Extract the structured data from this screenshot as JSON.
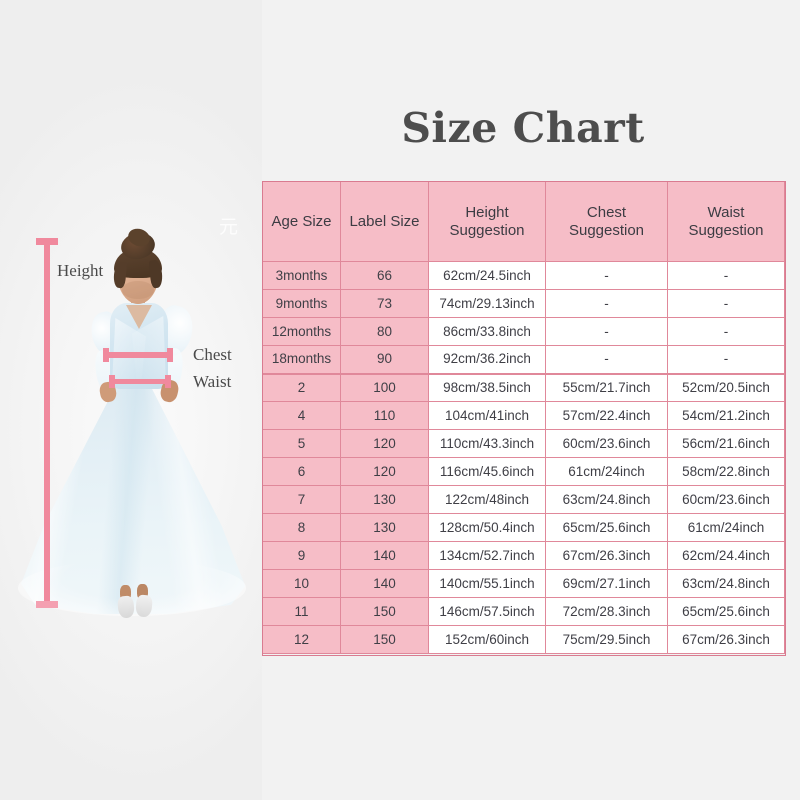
{
  "title": "Size Chart",
  "watermark": "元",
  "photo": {
    "alt_name": "girl-in-light-blue-tulle-dress",
    "annotations": [
      {
        "id": "height",
        "label": "Height"
      },
      {
        "id": "chest",
        "label": "Chest"
      },
      {
        "id": "waist",
        "label": "Waist"
      }
    ]
  },
  "colors": {
    "page_background": "#f2f2f2",
    "header_fill": "#f6bdc7",
    "cell_pink_fill": "#f6bdc7",
    "cell_white_fill": "#ffffff",
    "table_border": "#e0889a",
    "caliper_pink": "#f0899d",
    "title_text": "#4d4d4d",
    "body_text": "#3f3f46",
    "dress_blue": "#d3e6f1"
  },
  "chart_data": {
    "type": "table",
    "title": "Size Chart",
    "columns": [
      {
        "key": "age",
        "label": "Age Size",
        "lines": [
          "Age Size"
        ]
      },
      {
        "key": "label",
        "label": "Label Size",
        "lines": [
          "Label Size"
        ]
      },
      {
        "key": "height",
        "label": "Height Suggestion",
        "lines": [
          "Height",
          "Suggestion"
        ]
      },
      {
        "key": "chest",
        "label": "Chest Suggestion",
        "lines": [
          "Chest",
          "Suggestion"
        ]
      },
      {
        "key": "waist",
        "label": "Waist Suggestion",
        "lines": [
          "Waist",
          "Suggestion"
        ]
      }
    ],
    "rows": [
      {
        "age": "3months",
        "label": "66",
        "height": "62cm/24.5inch",
        "chest": "-",
        "waist": "-"
      },
      {
        "age": "9months",
        "label": "73",
        "height": "74cm/29.13inch",
        "chest": "-",
        "waist": "-"
      },
      {
        "age": "12months",
        "label": "80",
        "height": "86cm/33.8inch",
        "chest": "-",
        "waist": "-"
      },
      {
        "age": "18months",
        "label": "90",
        "height": "92cm/36.2inch",
        "chest": "-",
        "waist": "-"
      },
      {
        "age": "2",
        "label": "100",
        "height": "98cm/38.5inch",
        "chest": "55cm/21.7inch",
        "waist": "52cm/20.5inch"
      },
      {
        "age": "4",
        "label": "110",
        "height": "104cm/41inch",
        "chest": "57cm/22.4inch",
        "waist": "54cm/21.2inch"
      },
      {
        "age": "5",
        "label": "120",
        "height": "110cm/43.3inch",
        "chest": "60cm/23.6inch",
        "waist": "56cm/21.6inch"
      },
      {
        "age": "6",
        "label": "120",
        "height": "116cm/45.6inch",
        "chest": "61cm/24inch",
        "waist": "58cm/22.8inch"
      },
      {
        "age": "7",
        "label": "130",
        "height": "122cm/48inch",
        "chest": "63cm/24.8inch",
        "waist": "60cm/23.6inch"
      },
      {
        "age": "8",
        "label": "130",
        "height": "128cm/50.4inch",
        "chest": "65cm/25.6inch",
        "waist": "61cm/24inch"
      },
      {
        "age": "9",
        "label": "140",
        "height": "134cm/52.7inch",
        "chest": "67cm/26.3inch",
        "waist": "62cm/24.4inch"
      },
      {
        "age": "10",
        "label": "140",
        "height": "140cm/55.1inch",
        "chest": "69cm/27.1inch",
        "waist": "63cm/24.8inch"
      },
      {
        "age": "11",
        "label": "150",
        "height": "146cm/57.5inch",
        "chest": "72cm/28.3inch",
        "waist": "65cm/25.6inch"
      },
      {
        "age": "12",
        "label": "150",
        "height": "152cm/60inch",
        "chest": "75cm/29.5inch",
        "waist": "67cm/26.3inch"
      }
    ],
    "separator_after_row_index": 3,
    "pink_columns": [
      "age",
      "label"
    ],
    "white_columns": [
      "height",
      "chest",
      "waist"
    ]
  }
}
